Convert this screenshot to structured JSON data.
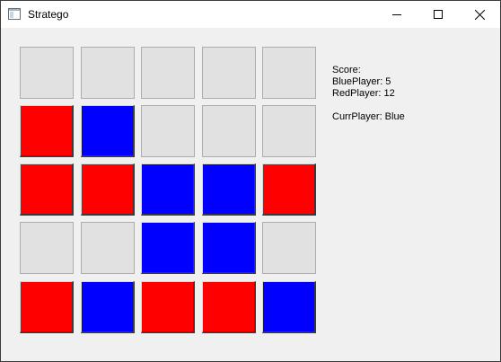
{
  "window": {
    "title": "Stratego",
    "app_icon": "window-app-icon",
    "controls": {
      "minimize_icon": "minimize-icon",
      "maximize_icon": "maximize-icon",
      "close_icon": "close-icon"
    }
  },
  "board": {
    "rows": 5,
    "cols": 5,
    "cells": [
      [
        "empty",
        "empty",
        "empty",
        "empty",
        "empty"
      ],
      [
        "red",
        "blue",
        "empty",
        "empty",
        "empty"
      ],
      [
        "red",
        "red",
        "blue",
        "blue",
        "red"
      ],
      [
        "empty",
        "empty",
        "blue",
        "blue",
        "empty"
      ],
      [
        "red",
        "blue",
        "red",
        "red",
        "blue"
      ]
    ],
    "colors": {
      "red": "#ff0000",
      "blue": "#0000ff",
      "empty": "#e1e1e1"
    }
  },
  "score": {
    "heading": "Score:",
    "blue_line": "BluePlayer: 5",
    "red_line": "RedPlayer: 12",
    "current_line": "CurrPlayer: Blue"
  }
}
